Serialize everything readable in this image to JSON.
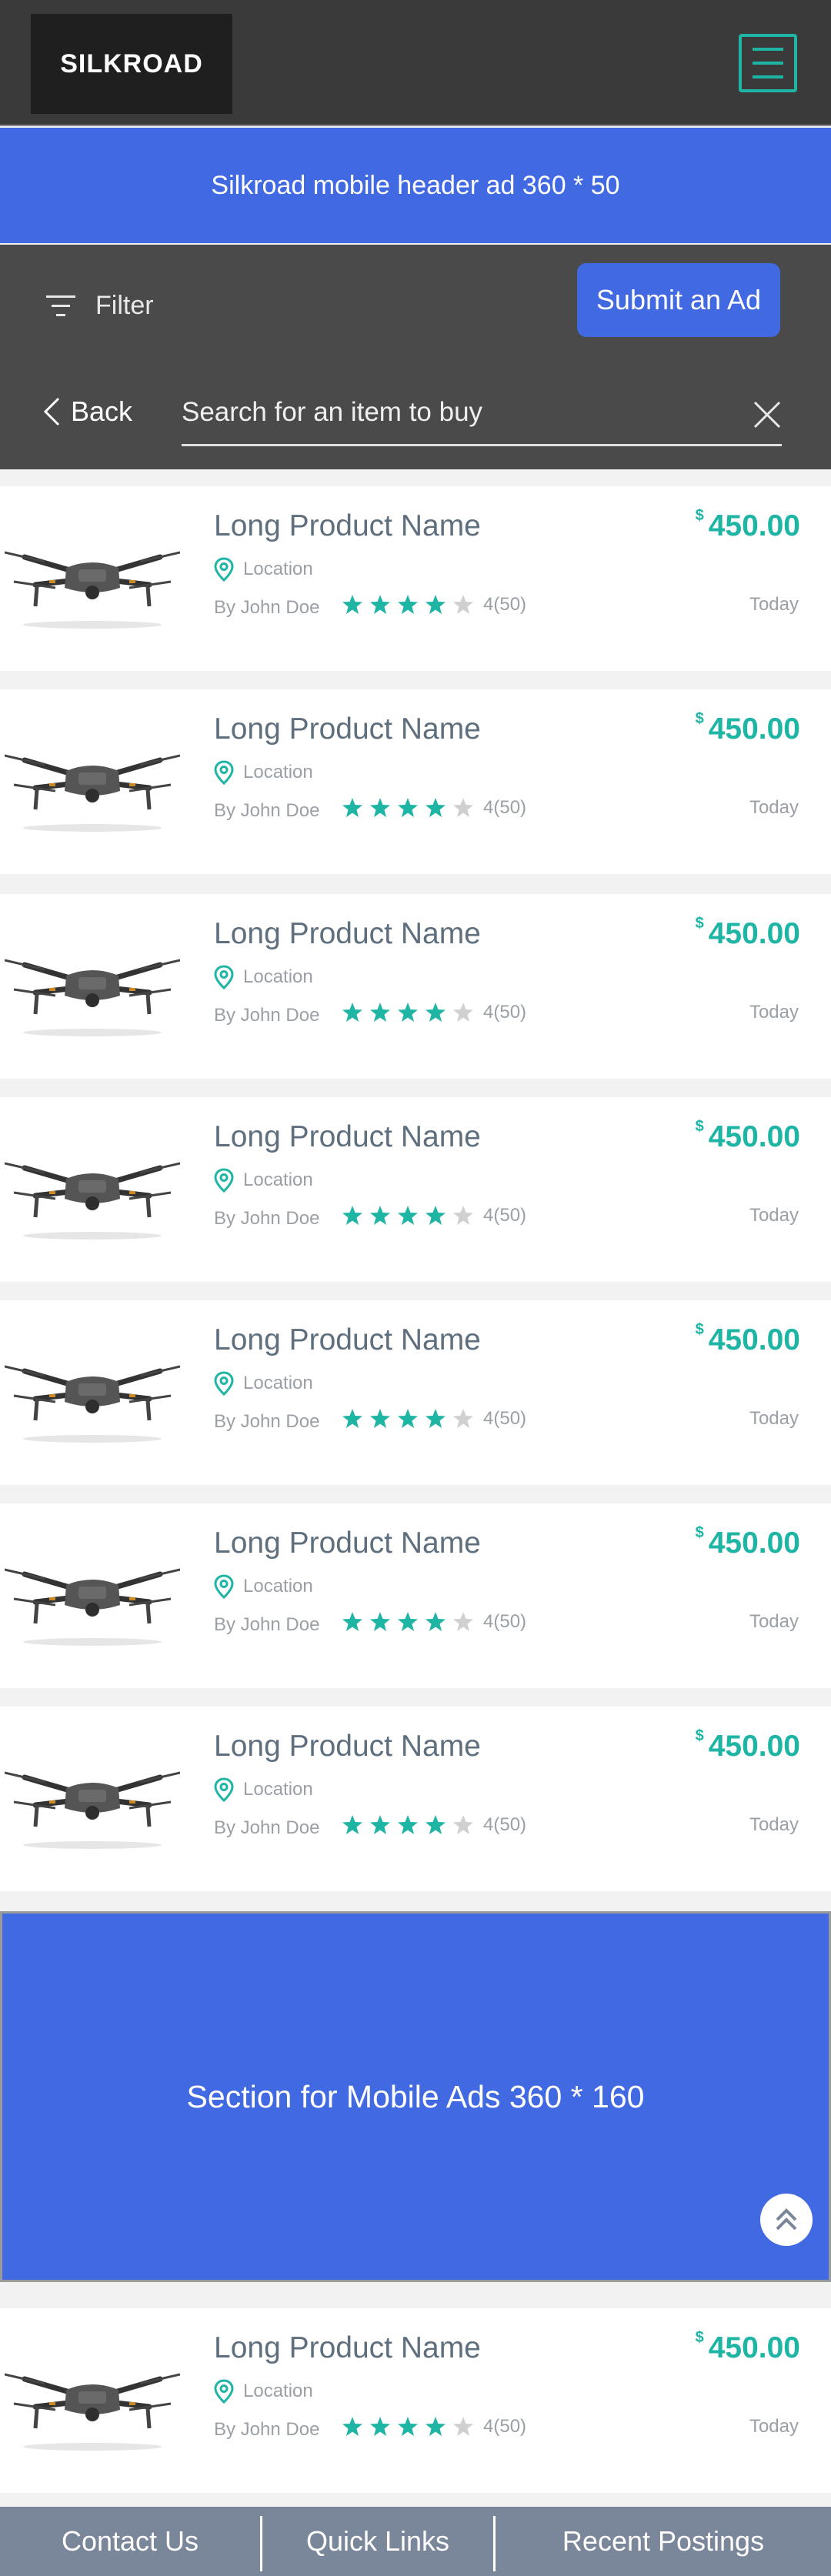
{
  "header": {
    "logo": "SILKROAD",
    "menu_icon": "hamburger-icon"
  },
  "header_ad": {
    "text": "Silkroad mobile header ad 360 * 50"
  },
  "controls": {
    "filter_label": "Filter",
    "submit_label": "Submit an Ad",
    "back_label": "Back",
    "search_placeholder": "Search for an item to buy",
    "search_value": ""
  },
  "listings": [
    {
      "name": "Long Product Name",
      "currency": "$",
      "price": "450.00",
      "location": "Location",
      "seller": "By John Doe",
      "rating": 4,
      "rating_label": "4(50)",
      "date": "Today"
    },
    {
      "name": "Long Product Name",
      "currency": "$",
      "price": "450.00",
      "location": "Location",
      "seller": "By John Doe",
      "rating": 4,
      "rating_label": "4(50)",
      "date": "Today"
    },
    {
      "name": "Long Product Name",
      "currency": "$",
      "price": "450.00",
      "location": "Location",
      "seller": "By John Doe",
      "rating": 4,
      "rating_label": "4(50)",
      "date": "Today"
    },
    {
      "name": "Long Product Name",
      "currency": "$",
      "price": "450.00",
      "location": "Location",
      "seller": "By John Doe",
      "rating": 4,
      "rating_label": "4(50)",
      "date": "Today"
    },
    {
      "name": "Long Product Name",
      "currency": "$",
      "price": "450.00",
      "location": "Location",
      "seller": "By John Doe",
      "rating": 4,
      "rating_label": "4(50)",
      "date": "Today"
    },
    {
      "name": "Long Product Name",
      "currency": "$",
      "price": "450.00",
      "location": "Location",
      "seller": "By John Doe",
      "rating": 4,
      "rating_label": "4(50)",
      "date": "Today"
    },
    {
      "name": "Long Product Name",
      "currency": "$",
      "price": "450.00",
      "location": "Location",
      "seller": "By John Doe",
      "rating": 4,
      "rating_label": "4(50)",
      "date": "Today"
    },
    {
      "name": "Long Product Name",
      "currency": "$",
      "price": "450.00",
      "location": "Location",
      "seller": "By John Doe",
      "rating": 4,
      "rating_label": "4(50)",
      "date": "Today"
    }
  ],
  "mid_ad": {
    "text": "Section for Mobile Ads 360 * 160"
  },
  "footer": {
    "links": [
      "Contact Us",
      "Quick Links",
      "Recent Postings"
    ]
  },
  "colors": {
    "accent": "#1fb5a5",
    "brand_blue": "#4169e1",
    "header_bg": "#3a3a3a",
    "footer_bg": "#7a8699"
  }
}
